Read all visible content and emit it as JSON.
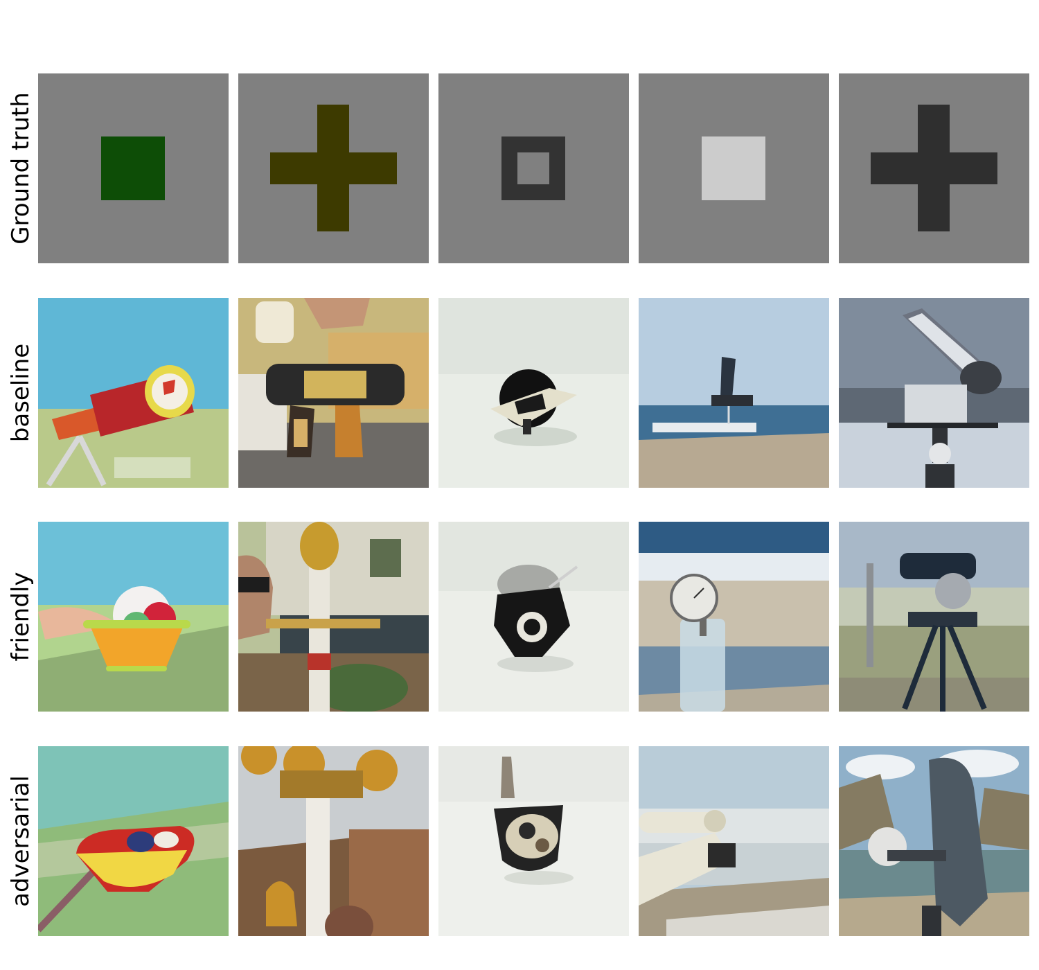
{
  "figure": {
    "rows": [
      {
        "label": "Ground truth",
        "cells": [
          {
            "shape": "filled-square",
            "color": "#0d4d06"
          },
          {
            "shape": "plus",
            "color": "#3d3a00"
          },
          {
            "shape": "hollow-square",
            "color": "#333333"
          },
          {
            "shape": "filled-square",
            "color": "#cccccc"
          },
          {
            "shape": "plus",
            "color": "#2f2f2f"
          }
        ]
      },
      {
        "label": "baseline",
        "cells": [
          {
            "subject": "orange tube with red can on stand",
            "sky": "#5fb7d6",
            "ground": "#b9c98a",
            "accent": "#d9582a"
          },
          {
            "subject": "hand holding bottle over toy robot",
            "sky": "#c8b77c",
            "ground": "#6d6a66",
            "accent": "#2a2a2a"
          },
          {
            "subject": "small black metal spaceship figurine",
            "sky": "#dfe4de",
            "ground": "#e9ede7",
            "accent": "#111111"
          },
          {
            "subject": "sailboat on sea beside pier",
            "sky": "#b7cde0",
            "ground": "#b7a992",
            "accent": "#3f6f94"
          },
          {
            "subject": "metal telescope on stand under cloudy sky",
            "sky": "#7f8c9c",
            "ground": "#c9d2dc",
            "accent": "#dfe3e8"
          }
        ]
      },
      {
        "label": "friendly",
        "cells": [
          {
            "subject": "colorful toy bowl with balls",
            "sky": "#6cc0d8",
            "ground": "#8fae74",
            "accent": "#f2a52a"
          },
          {
            "subject": "man beside tall ornate pillar",
            "sky": "#b9c29a",
            "ground": "#4a6a3a",
            "accent": "#c79b2e"
          },
          {
            "subject": "black metal camera-like trinket",
            "sky": "#e2e6e0",
            "ground": "#eceee9",
            "accent": "#161616"
          },
          {
            "subject": "gauge on glass bottle at beach",
            "sky": "#9fb6c8",
            "ground": "#c9c0ad",
            "accent": "#6d8aa3"
          },
          {
            "subject": "telescope on tripod near wall",
            "sky": "#a8b8c8",
            "ground": "#9aa07e",
            "accent": "#1e2b3a"
          }
        ]
      },
      {
        "label": "adversarial",
        "cells": [
          {
            "subject": "red toy capsule over speckled field",
            "sky": "#7ec3b7",
            "ground": "#8fbb7a",
            "accent": "#cc2b24"
          },
          {
            "subject": "yellow helmeted statue on pole",
            "sky": "#c9cdd0",
            "ground": "#7b5a3e",
            "accent": "#c9912a"
          },
          {
            "subject": "metal turret figurine on white table",
            "sky": "#e7e9e5",
            "ground": "#eef0ec",
            "accent": "#232323"
          },
          {
            "subject": "rocket pieces on rocky shore",
            "sky": "#b9ccd8",
            "ground": "#a59a84",
            "accent": "#e8e5d6"
          },
          {
            "subject": "robotic arm with shield in canyon",
            "sky": "#8fb0c9",
            "ground": "#857b62",
            "accent": "#4d5963"
          }
        ]
      }
    ]
  }
}
